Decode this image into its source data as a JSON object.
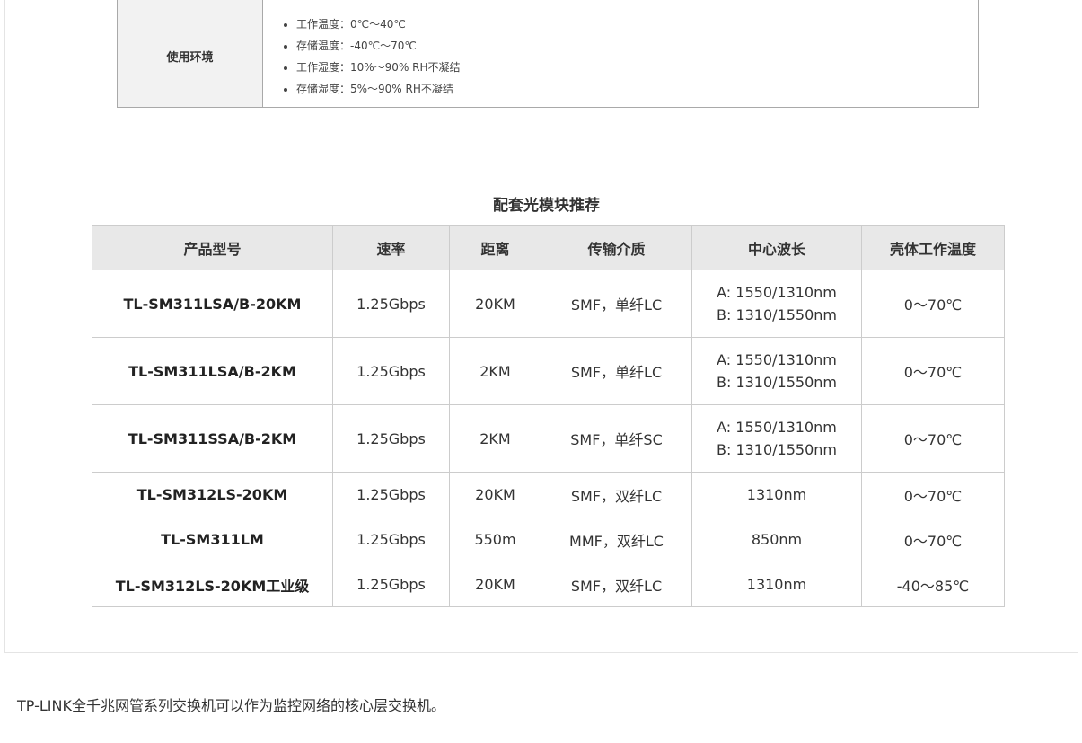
{
  "spec": {
    "label": "使用环境",
    "items": [
      "工作温度：0℃～40℃",
      "存储温度：-40℃～70℃",
      "工作湿度：10%～90% RH不凝结",
      "存储湿度：5%～90% RH不凝结"
    ]
  },
  "modules": {
    "title": "配套光模块推荐",
    "headers": [
      "产品型号",
      "速率",
      "距离",
      "传输介质",
      "中心波长",
      "壳体工作温度"
    ],
    "rows": [
      {
        "model": "TL-SM311LSA/B-20KM",
        "rate": "1.25Gbps",
        "distance": "20KM",
        "medium": "SMF，单纤LC",
        "wave1": "A: 1550/1310nm",
        "wave2": "B: 1310/1550nm",
        "temp": "0～70℃"
      },
      {
        "model": "TL-SM311LSA/B-2KM",
        "rate": "1.25Gbps",
        "distance": "2KM",
        "medium": "SMF，单纤LC",
        "wave1": "A: 1550/1310nm",
        "wave2": "B: 1310/1550nm",
        "temp": "0～70℃"
      },
      {
        "model": "TL-SM311SSA/B-2KM",
        "rate": "1.25Gbps",
        "distance": "2KM",
        "medium": "SMF，单纤SC",
        "wave1": "A: 1550/1310nm",
        "wave2": "B: 1310/1550nm",
        "temp": "0～70℃"
      },
      {
        "model": "TL-SM312LS-20KM",
        "rate": "1.25Gbps",
        "distance": "20KM",
        "medium": "SMF，双纤LC",
        "wave1": "1310nm",
        "wave2": "",
        "temp": "0～70℃"
      },
      {
        "model": "TL-SM311LM",
        "rate": "1.25Gbps",
        "distance": "550m",
        "medium": "MMF，双纤LC",
        "wave1": "850nm",
        "wave2": "",
        "temp": "0～70℃"
      },
      {
        "model": "TL-SM312LS-20KM工业级",
        "rate": "1.25Gbps",
        "distance": "20KM",
        "medium": "SMF，双纤LC",
        "wave1": "1310nm",
        "wave2": "",
        "temp": "-40～85℃"
      }
    ]
  },
  "footer": {
    "text": "TP-LINK全千兆网管系列交换机可以作为监控网络的核心层交换机。"
  }
}
